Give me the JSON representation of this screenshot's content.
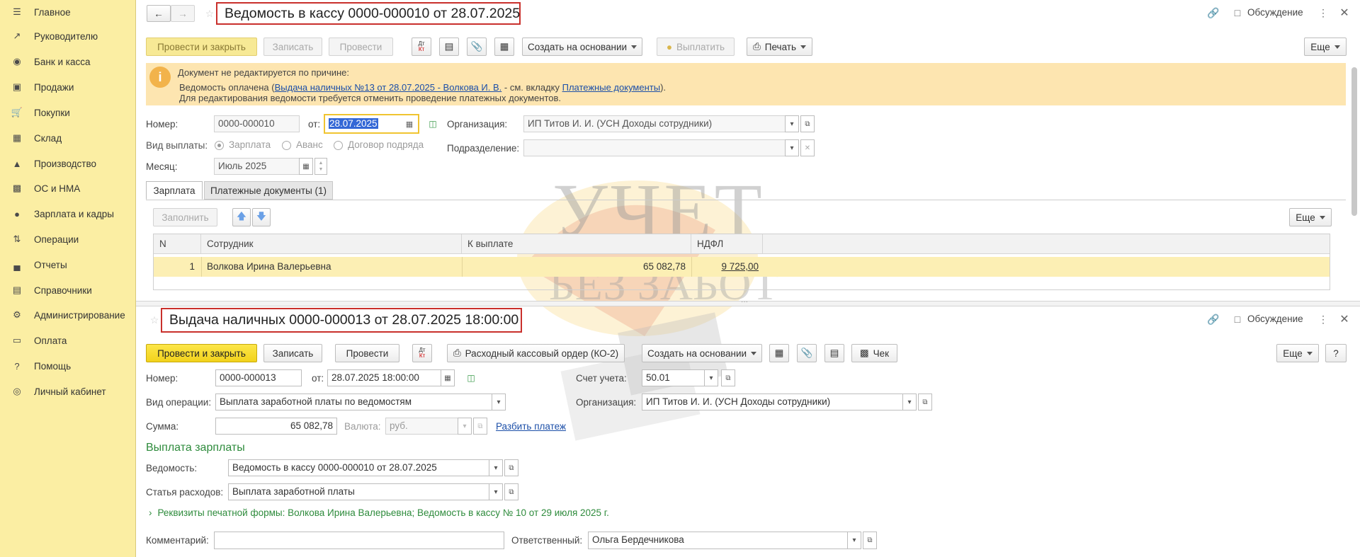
{
  "sidebar": {
    "items": [
      {
        "label": "Главное",
        "icon": "menu-icon"
      },
      {
        "label": "Руководителю",
        "icon": "trend-icon"
      },
      {
        "label": "Банк и касса",
        "icon": "coin-icon"
      },
      {
        "label": "Продажи",
        "icon": "bag-icon"
      },
      {
        "label": "Покупки",
        "icon": "cart-icon"
      },
      {
        "label": "Склад",
        "icon": "grid-icon"
      },
      {
        "label": "Производство",
        "icon": "factory-icon"
      },
      {
        "label": "ОС и НМА",
        "icon": "truck-icon"
      },
      {
        "label": "Зарплата и кадры",
        "icon": "person-icon"
      },
      {
        "label": "Операции",
        "icon": "dt-kt-icon"
      },
      {
        "label": "Отчеты",
        "icon": "bar-chart-icon"
      },
      {
        "label": "Справочники",
        "icon": "book-icon"
      },
      {
        "label": "Администрирование",
        "icon": "gear-icon"
      },
      {
        "label": "Оплата",
        "icon": "wallet-icon"
      },
      {
        "label": "Помощь",
        "icon": "question-icon"
      },
      {
        "label": "Личный кабинет",
        "icon": "account-icon"
      }
    ]
  },
  "doc1": {
    "title": "Ведомость в кассу 0000-000010 от 28.07.2025",
    "discussion": "Обсуждение",
    "toolbar": {
      "post_close": "Провести и закрыть",
      "save": "Записать",
      "post": "Провести",
      "dtkt_top": "Дт",
      "dtkt_bottom": "Кт",
      "create_based": "Создать на основании",
      "pay": "Выплатить",
      "print": "Печать",
      "more": "Еще"
    },
    "banner": {
      "line1": "Документ не редактируется по причине:",
      "line2_pre": "Ведомость оплачена (",
      "line2_link": "Выдача наличных №13 от 28.07.2025 - Волкова И. В.",
      "line2_mid": " - см. вкладку ",
      "line2_link2": "Платежные документы",
      "line2_post": ").",
      "line3": "Для редактирования ведомости требуется отменить проведение платежных документов."
    },
    "number_label": "Номер:",
    "number": "0000-000010",
    "date_label": "от:",
    "date": "28.07.2025",
    "org_label": "Организация:",
    "org": "ИП Титов И. И. (УСН Доходы сотрудники)",
    "pay_type_label": "Вид выплаты:",
    "pay_types": [
      "Зарплата",
      "Аванс",
      "Договор подряда"
    ],
    "dept_label": "Подразделение:",
    "dept": "",
    "month_label": "Месяц:",
    "month": "Июль 2025",
    "tabs": [
      "Зарплата",
      "Платежные документы (1)"
    ],
    "fill": "Заполнить",
    "more2": "Еще",
    "table": {
      "headers": [
        "N",
        "Сотрудник",
        "К выплате",
        "НДФЛ"
      ],
      "rows": [
        {
          "n": "1",
          "employee": "Волкова Ирина Валерьевна",
          "amount": "65 082,78",
          "ndfl": "9 725,00"
        }
      ]
    }
  },
  "doc2": {
    "title": "Выдача наличных 0000-000013 от 28.07.2025 18:00:00",
    "discussion": "Обсуждение",
    "toolbar": {
      "post_close": "Провести и закрыть",
      "save": "Записать",
      "post": "Провести",
      "dtkt_top": "Дт",
      "dtkt_bottom": "Кт",
      "ko2": "Расходный кассовый ордер (КО-2)",
      "create_based": "Создать на основании",
      "check": "Чек",
      "more": "Еще",
      "help": "?"
    },
    "number_label": "Номер:",
    "number": "0000-000013",
    "date_label": "от:",
    "date": "28.07.2025 18:00:00",
    "account_label": "Счет учета:",
    "account": "50.01",
    "op_type_label": "Вид операции:",
    "op_type": "Выплата заработной платы по ведомостям",
    "org_label": "Организация:",
    "org": "ИП Титов И. И. (УСН Доходы сотрудники)",
    "sum_label": "Сумма:",
    "sum": "65 082,78",
    "currency_label": "Валюта:",
    "currency": "руб.",
    "split_link": "Разбить платеж",
    "section_title": "Выплата зарплаты",
    "statement_label": "Ведомость:",
    "statement": "Ведомость в кассу 0000-000010 от 28.07.2025",
    "expense_label": "Статья расходов:",
    "expense": "Выплата заработной платы",
    "print_details": "Реквизиты печатной формы: Волкова Ирина Валерьевна; Ведомость в кассу № 10 от 29 июля 2025 г.",
    "comment_label": "Комментарий:",
    "comment": "",
    "responsible_label": "Ответственный:",
    "responsible": "Ольга Бердечникова"
  },
  "watermark": {
    "line1": "УЧЕТ",
    "line2": "БЕЗ ЗАБОТ"
  },
  "colors": {
    "sidebar_bg": "#fbeea3",
    "accent_yellow": "#f2d21b",
    "title_border": "#c9302c",
    "link": "#1c4fa8",
    "section_green": "#2e8b3c"
  }
}
